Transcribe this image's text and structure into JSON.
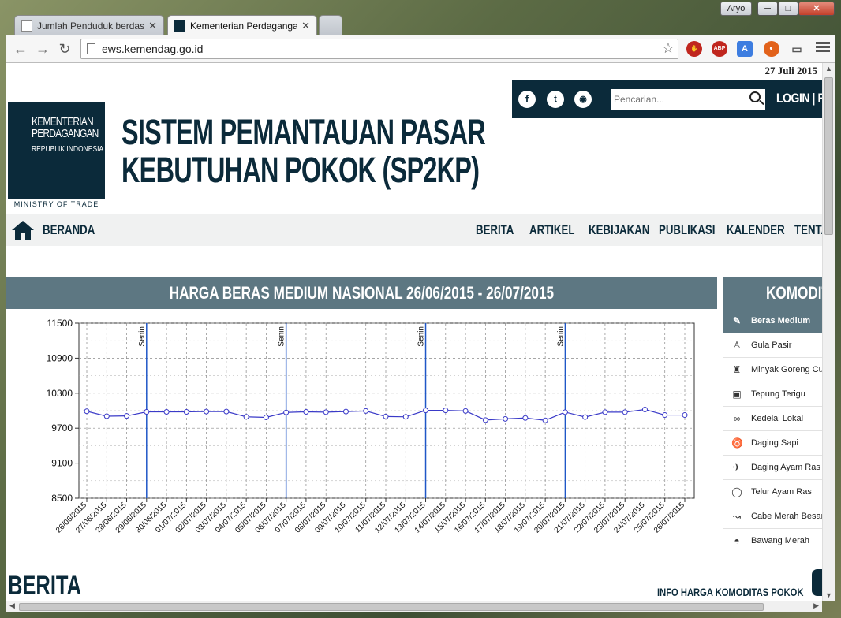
{
  "browser": {
    "tabs": [
      {
        "label": "Jumlah Penduduk berdasa",
        "active": false
      },
      {
        "label": "Kementerian Perdagangan",
        "active": true
      }
    ],
    "user": "Aryo",
    "url": "ews.kemendag.go.id",
    "window_buttons": {
      "min": "─",
      "max": "□",
      "close": "✕"
    }
  },
  "page": {
    "date": "27 Juli 2015",
    "social": [
      "facebook-icon",
      "twitter-icon",
      "rss-icon"
    ],
    "search_placeholder": "Pencarian...",
    "login": "LOGIN | R",
    "logo": {
      "line1": "KEMENTERIAN",
      "line2": "PERDAGANGAN",
      "line3": "REPUBLIK INDONESIA",
      "sub": "MINISTRY OF TRADE"
    },
    "title_line1": "SISTEM PEMANTAUAN PASAR",
    "title_line2": "KEBUTUHAN POKOK (SP2KP)",
    "nav": {
      "home": "BERANDA",
      "items": [
        "BERITA",
        "ARTIKEL",
        "KEBIJAKAN",
        "PUBLIKASI",
        "KALENDER",
        "TENTA"
      ]
    },
    "chart_title": "HARGA BERAS MEDIUM NASIONAL 26/06/2015 - 26/07/2015",
    "side_title": "KOMODITA",
    "komoditas": [
      {
        "label": "Beras Medium",
        "icon": "rice-icon",
        "active": true
      },
      {
        "label": "Gula Pasir",
        "icon": "sugar-icon",
        "active": false
      },
      {
        "label": "Minyak Goreng Cu",
        "icon": "oil-icon",
        "active": false
      },
      {
        "label": "Tepung Terigu",
        "icon": "flour-icon",
        "active": false
      },
      {
        "label": "Kedelai Lokal",
        "icon": "soybean-icon",
        "active": false
      },
      {
        "label": "Daging Sapi",
        "icon": "beef-icon",
        "active": false
      },
      {
        "label": "Daging Ayam Ras",
        "icon": "chicken-icon",
        "active": false
      },
      {
        "label": "Telur Ayam Ras",
        "icon": "egg-icon",
        "active": false
      },
      {
        "label": "Cabe Merah Besar",
        "icon": "chili-icon",
        "active": false
      },
      {
        "label": "Bawang Merah",
        "icon": "onion-icon",
        "active": false
      }
    ],
    "berita_title": "BERITA",
    "info_title": "INFO HARGA KOMODITAS POKOK"
  },
  "chart_data": {
    "type": "line",
    "title": "HARGA BERAS MEDIUM NASIONAL 26/06/2015 - 26/07/2015",
    "x": [
      "26/06/2015",
      "27/06/2015",
      "28/06/2015",
      "29/06/2015",
      "30/06/2015",
      "01/07/2015",
      "02/07/2015",
      "03/07/2015",
      "04/07/2015",
      "05/07/2015",
      "06/07/2015",
      "07/07/2015",
      "08/07/2015",
      "09/07/2015",
      "10/07/2015",
      "11/07/2015",
      "12/07/2015",
      "13/07/2015",
      "14/07/2015",
      "15/07/2015",
      "16/07/2015",
      "17/07/2015",
      "18/07/2015",
      "19/07/2015",
      "20/07/2015",
      "21/07/2015",
      "22/07/2015",
      "23/07/2015",
      "24/07/2015",
      "25/07/2015",
      "26/07/2015"
    ],
    "series": [
      {
        "values": [
          9990,
          9905,
          9910,
          9980,
          9980,
          9980,
          9985,
          9985,
          9895,
          9885,
          9970,
          9980,
          9975,
          9985,
          9995,
          9900,
          9895,
          10005,
          10005,
          9995,
          9840,
          9860,
          9875,
          9835,
          9975,
          9890,
          9975,
          9975,
          10020,
          9925,
          9925
        ]
      }
    ],
    "ylim": [
      8500,
      11500
    ],
    "yticks": [
      8500,
      9100,
      9700,
      10300,
      10900,
      11500
    ],
    "markers": [
      {
        "x": "29/06/2015",
        "label": "Senin"
      },
      {
        "x": "06/07/2015",
        "label": "Senin"
      },
      {
        "x": "13/07/2015",
        "label": "Senin"
      },
      {
        "x": "20/07/2015",
        "label": "Senin"
      }
    ],
    "grid": true,
    "line_color": "#3a3ac8",
    "marker_line_color": "#1f57c7"
  }
}
